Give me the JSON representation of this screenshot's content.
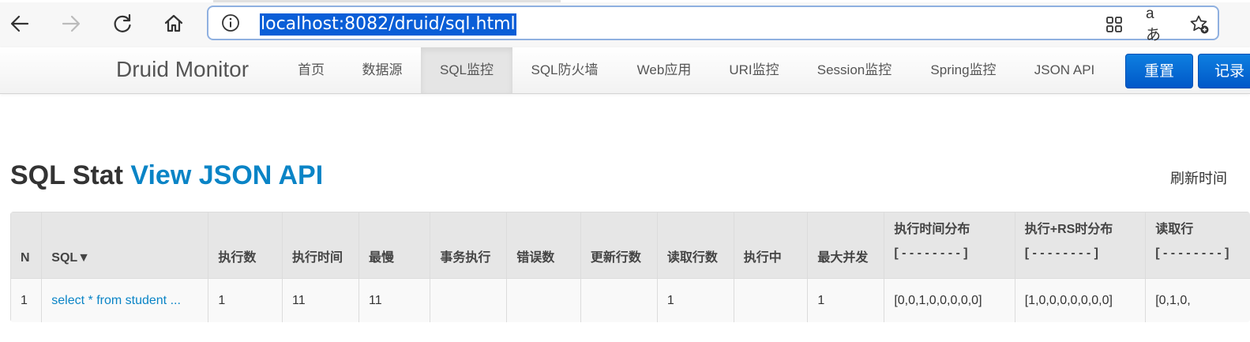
{
  "browser": {
    "url": "localhost:8082/druid/sql.html"
  },
  "navbar": {
    "brand": "Druid Monitor",
    "items": [
      {
        "label": "首页",
        "active": false
      },
      {
        "label": "数据源",
        "active": false
      },
      {
        "label": "SQL监控",
        "active": true
      },
      {
        "label": "SQL防火墙",
        "active": false
      },
      {
        "label": "Web应用",
        "active": false
      },
      {
        "label": "URI监控",
        "active": false
      },
      {
        "label": "Session监控",
        "active": false
      },
      {
        "label": "Spring监控",
        "active": false
      },
      {
        "label": "JSON API",
        "active": false
      }
    ],
    "reset_label": "重置",
    "log_label": "记录"
  },
  "main": {
    "title": "SQL Stat",
    "json_api_link": "View JSON API",
    "refresh_label": "刷新时间"
  },
  "table": {
    "headers": [
      "N",
      "SQL▼",
      "执行数",
      "执行时间",
      "最慢",
      "事务执行",
      "错误数",
      "更新行数",
      "读取行数",
      "执行中",
      "最大并发",
      "执行时间分布",
      "执行+RS时分布",
      "读取行"
    ],
    "header_sub": "[ - - - - - - - - ]",
    "rows": [
      {
        "n": "1",
        "sql": "select * from student ...",
        "exec_count": "1",
        "exec_time": "11",
        "slowest": "11",
        "tx_exec": "",
        "errors": "",
        "update_rows": "",
        "read_rows": "1",
        "running": "",
        "max_concurrent": "1",
        "time_hist": "[0,0,1,0,0,0,0,0]",
        "rs_hist": "[1,0,0,0,0,0,0,0]",
        "read_hist": "[0,1,0,"
      }
    ]
  }
}
